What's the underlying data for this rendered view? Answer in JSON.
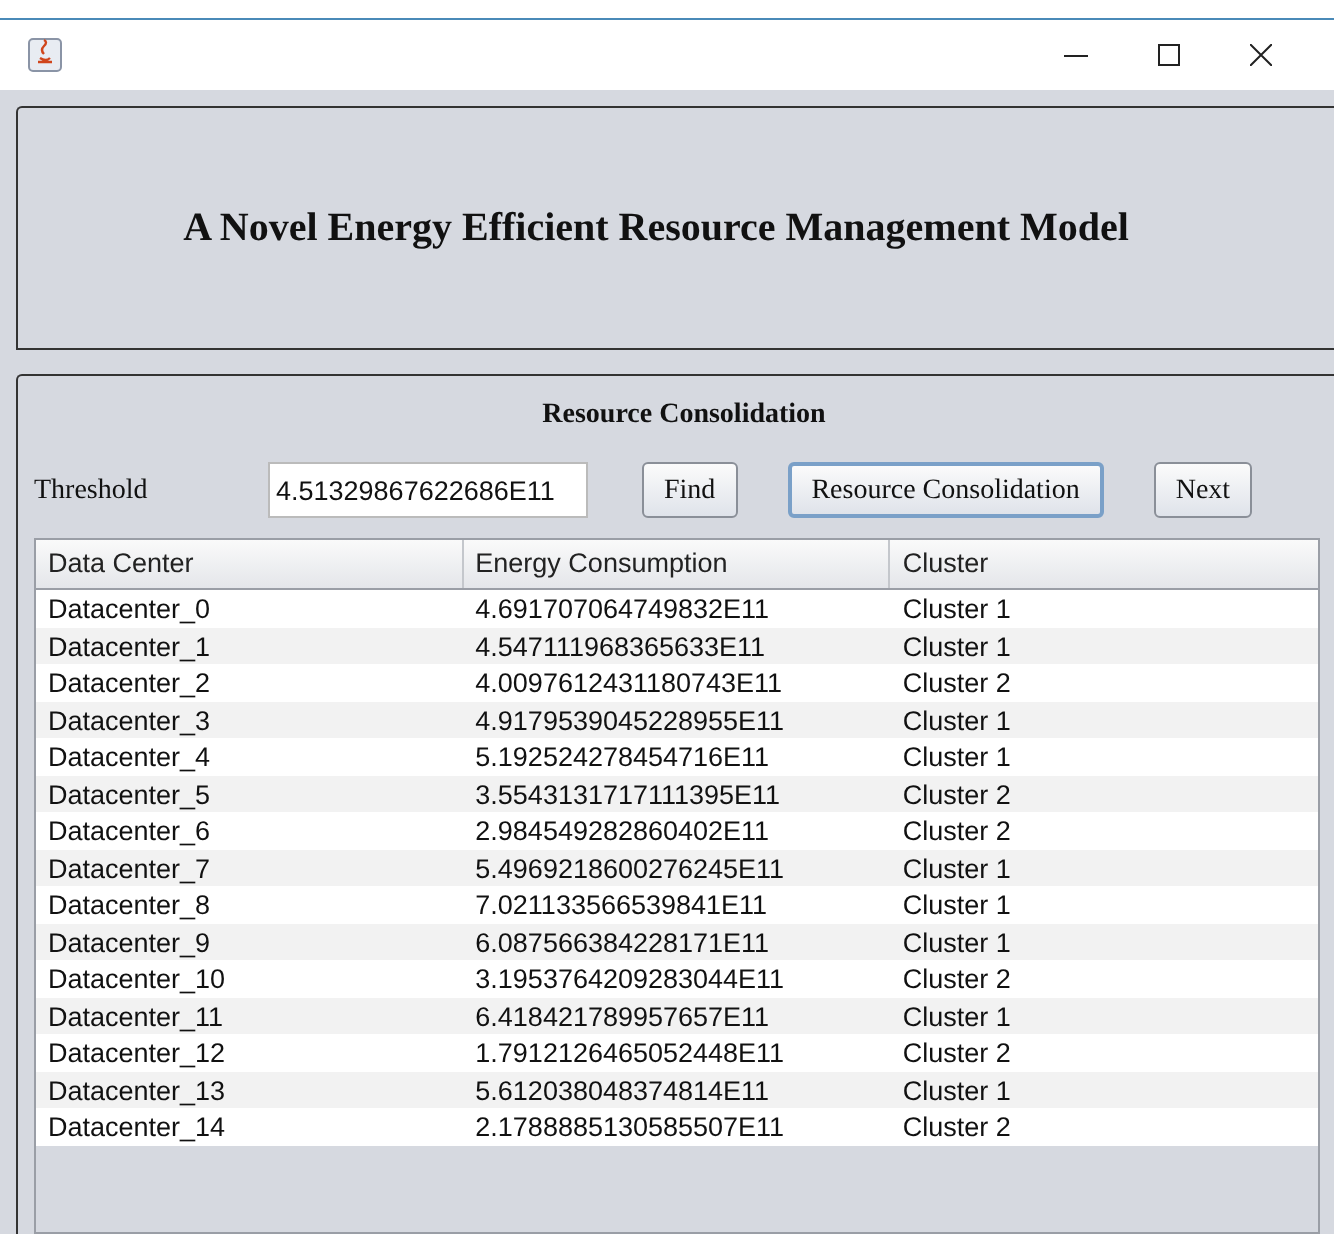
{
  "header": {
    "title": "A Novel Energy Efficient Resource Management Model"
  },
  "panel": {
    "title": "Resource Consolidation",
    "threshold_label": "Threshold",
    "threshold_value": "4.51329867622686E11",
    "buttons": [
      {
        "label": "Find",
        "selected": false
      },
      {
        "label": "Resource Consolidation",
        "selected": true
      },
      {
        "label": "Next",
        "selected": false
      }
    ]
  },
  "table": {
    "columns": [
      "Data Center",
      "Energy Consumption",
      "Cluster"
    ],
    "rows": [
      [
        "Datacenter_0",
        "4.691707064749832E11",
        "Cluster 1"
      ],
      [
        "Datacenter_1",
        "4.547111968365633E11",
        "Cluster 1"
      ],
      [
        "Datacenter_2",
        "4.0097612431180743E11",
        "Cluster 2"
      ],
      [
        "Datacenter_3",
        "4.9179539045228955E11",
        "Cluster 1"
      ],
      [
        "Datacenter_4",
        "5.192524278454716E11",
        "Cluster 1"
      ],
      [
        "Datacenter_5",
        "3.5543131717111395E11",
        "Cluster 2"
      ],
      [
        "Datacenter_6",
        "2.984549282860402E11",
        "Cluster 2"
      ],
      [
        "Datacenter_7",
        "5.4969218600276245E11",
        "Cluster 1"
      ],
      [
        "Datacenter_8",
        "7.021133566539841E11",
        "Cluster 1"
      ],
      [
        "Datacenter_9",
        "6.087566384228171E11",
        "Cluster 1"
      ],
      [
        "Datacenter_10",
        "3.1953764209283044E11",
        "Cluster 2"
      ],
      [
        "Datacenter_11",
        "6.418421789957657E11",
        "Cluster 1"
      ],
      [
        "Datacenter_12",
        "1.7912126465052448E11",
        "Cluster 2"
      ],
      [
        "Datacenter_13",
        "5.612038048374814E11",
        "Cluster 1"
      ],
      [
        "Datacenter_14",
        "2.1788885130585507E11",
        "Cluster 2"
      ]
    ]
  }
}
